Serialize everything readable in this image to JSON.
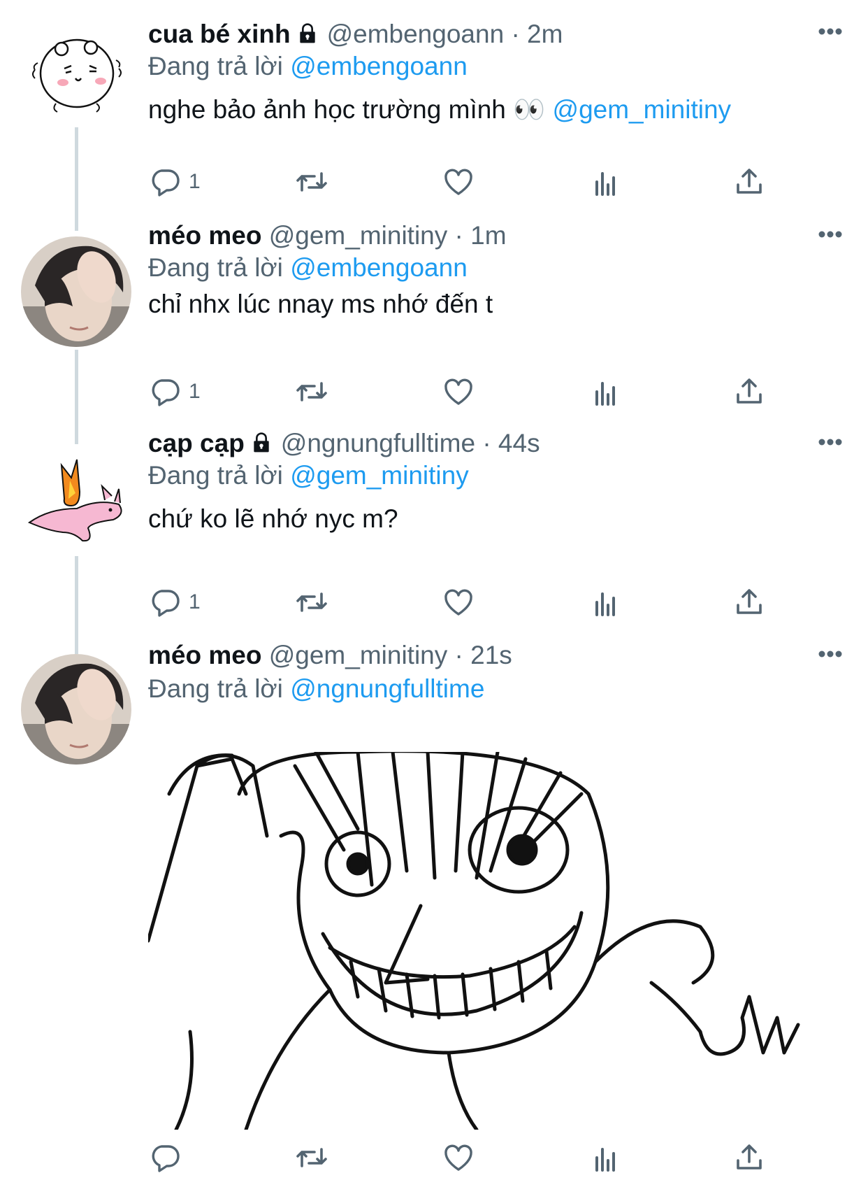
{
  "tweets": [
    {
      "display_name": "cua bé xinh",
      "handle": "@embengoann",
      "time": "· 2m",
      "replying_label": "Đang trả lời",
      "replying_to": "@embengoann",
      "text": "nghe bảo ảnh học trường mình 👀",
      "text_mention": "@gem_minitiny",
      "reply_count": "1",
      "locked": true
    },
    {
      "display_name": "méo meo",
      "handle": "@gem_minitiny",
      "time": "· 1m",
      "replying_label": "Đang trả lời",
      "replying_to": "@embengoann",
      "text": "chỉ nhx lúc nnay ms nhớ đến t",
      "reply_count": "1",
      "locked": false
    },
    {
      "display_name": "cạp cạp",
      "handle": "@ngnungfulltime",
      "time": "· 44s",
      "replying_label": "Đang trả lời",
      "replying_to": "@gem_minitiny",
      "text": "chứ ko lẽ nhớ nyc m?",
      "reply_count": "1",
      "locked": true
    },
    {
      "display_name": "méo meo",
      "handle": "@gem_minitiny",
      "time": "· 21s",
      "replying_label": "Đang trả lời",
      "replying_to": "@ngnungfulltime",
      "reply_count": "",
      "locked": false
    }
  ],
  "icons": {
    "reply": "reply-icon",
    "retweet": "retweet-icon",
    "like": "heart-icon",
    "views": "analytics-icon",
    "share": "share-icon",
    "more": "more-icon",
    "lock": "lock-icon"
  },
  "colors": {
    "accent": "#1d9bf0",
    "muted": "#536471",
    "text": "#0f1419",
    "thread_line": "#cfd9de"
  }
}
